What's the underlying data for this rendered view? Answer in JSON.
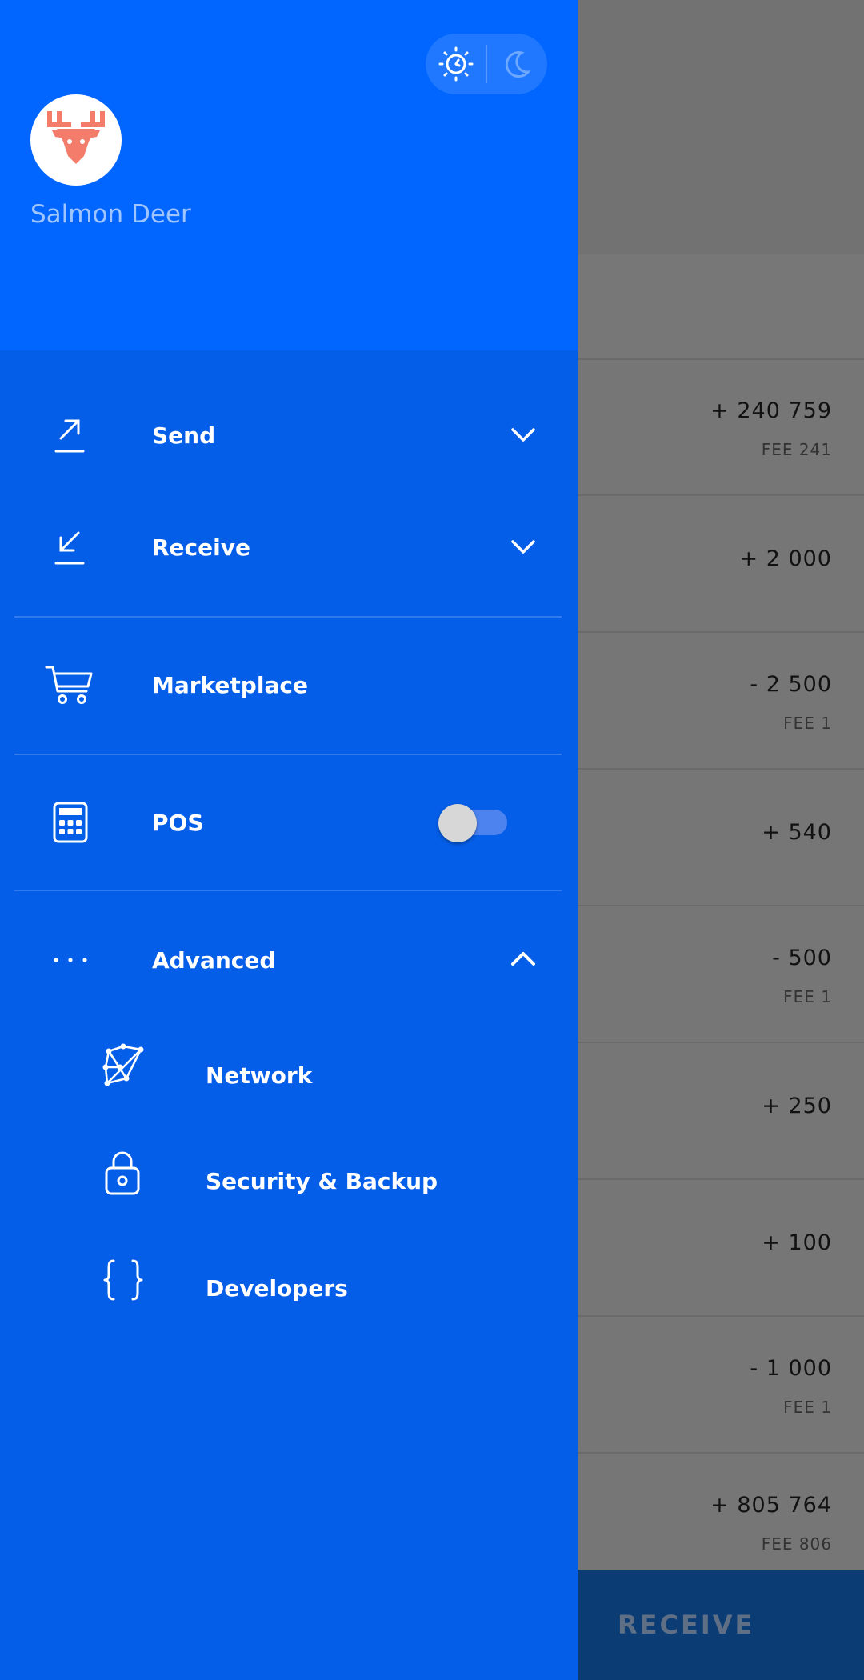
{
  "profile": {
    "name": "Salmon Deer"
  },
  "menu": {
    "send": "Send",
    "receive": "Receive",
    "marketplace": "Marketplace",
    "pos": "POS",
    "pos_enabled": false,
    "advanced": "Advanced",
    "advanced_expanded": true,
    "advanced_items": [
      {
        "label": "Network",
        "icon": "network-icon"
      },
      {
        "label": "Security & Backup",
        "icon": "lock-icon"
      },
      {
        "label": "Developers",
        "icon": "braces-icon"
      }
    ]
  },
  "background": {
    "transactions": [
      {
        "amount": "+ 240 759",
        "fee": "FEE 241"
      },
      {
        "amount": "+ 2 000",
        "fee": ""
      },
      {
        "amount": "- 2 500",
        "fee": "FEE 1"
      },
      {
        "amount": "+ 540",
        "fee": ""
      },
      {
        "amount": "- 500",
        "fee": "FEE 1"
      },
      {
        "amount": "+ 250",
        "fee": ""
      },
      {
        "amount": "+ 100",
        "fee": ""
      },
      {
        "amount": "- 1 000",
        "fee": "FEE 1"
      },
      {
        "amount": "+ 805 764",
        "fee": "FEE 806"
      }
    ],
    "bottom_button": "RECEIVE"
  },
  "colors": {
    "drawer": "#055ee8",
    "header": "#0066ff",
    "avatar_icon": "#f47c6a"
  }
}
